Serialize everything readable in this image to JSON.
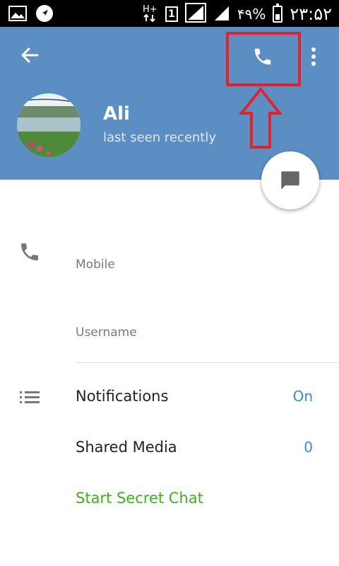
{
  "status_bar": {
    "sim_label": "1",
    "battery_text": "۴۹%",
    "time": "۲۳:۵۲"
  },
  "header": {
    "name": "Ali",
    "last_seen": "last seen recently"
  },
  "info": {
    "mobile_label": "Mobile",
    "username_label": "Username"
  },
  "settings": {
    "notifications_label": "Notifications",
    "notifications_value": "On",
    "shared_media_label": "Shared Media",
    "shared_media_value": "0",
    "secret_chat_label": "Start Secret Chat"
  },
  "colors": {
    "header_bg": "#5b8fc3",
    "accent_blue": "#3a8ad6",
    "secret_green": "#3fb223",
    "highlight_red": "#e2232a"
  },
  "icons": [
    "image-icon",
    "navigation-icon",
    "signal-icon",
    "battery-icon",
    "back-arrow-icon",
    "phone-icon",
    "more-vert-icon",
    "chat-bubble-icon",
    "list-icon"
  ]
}
